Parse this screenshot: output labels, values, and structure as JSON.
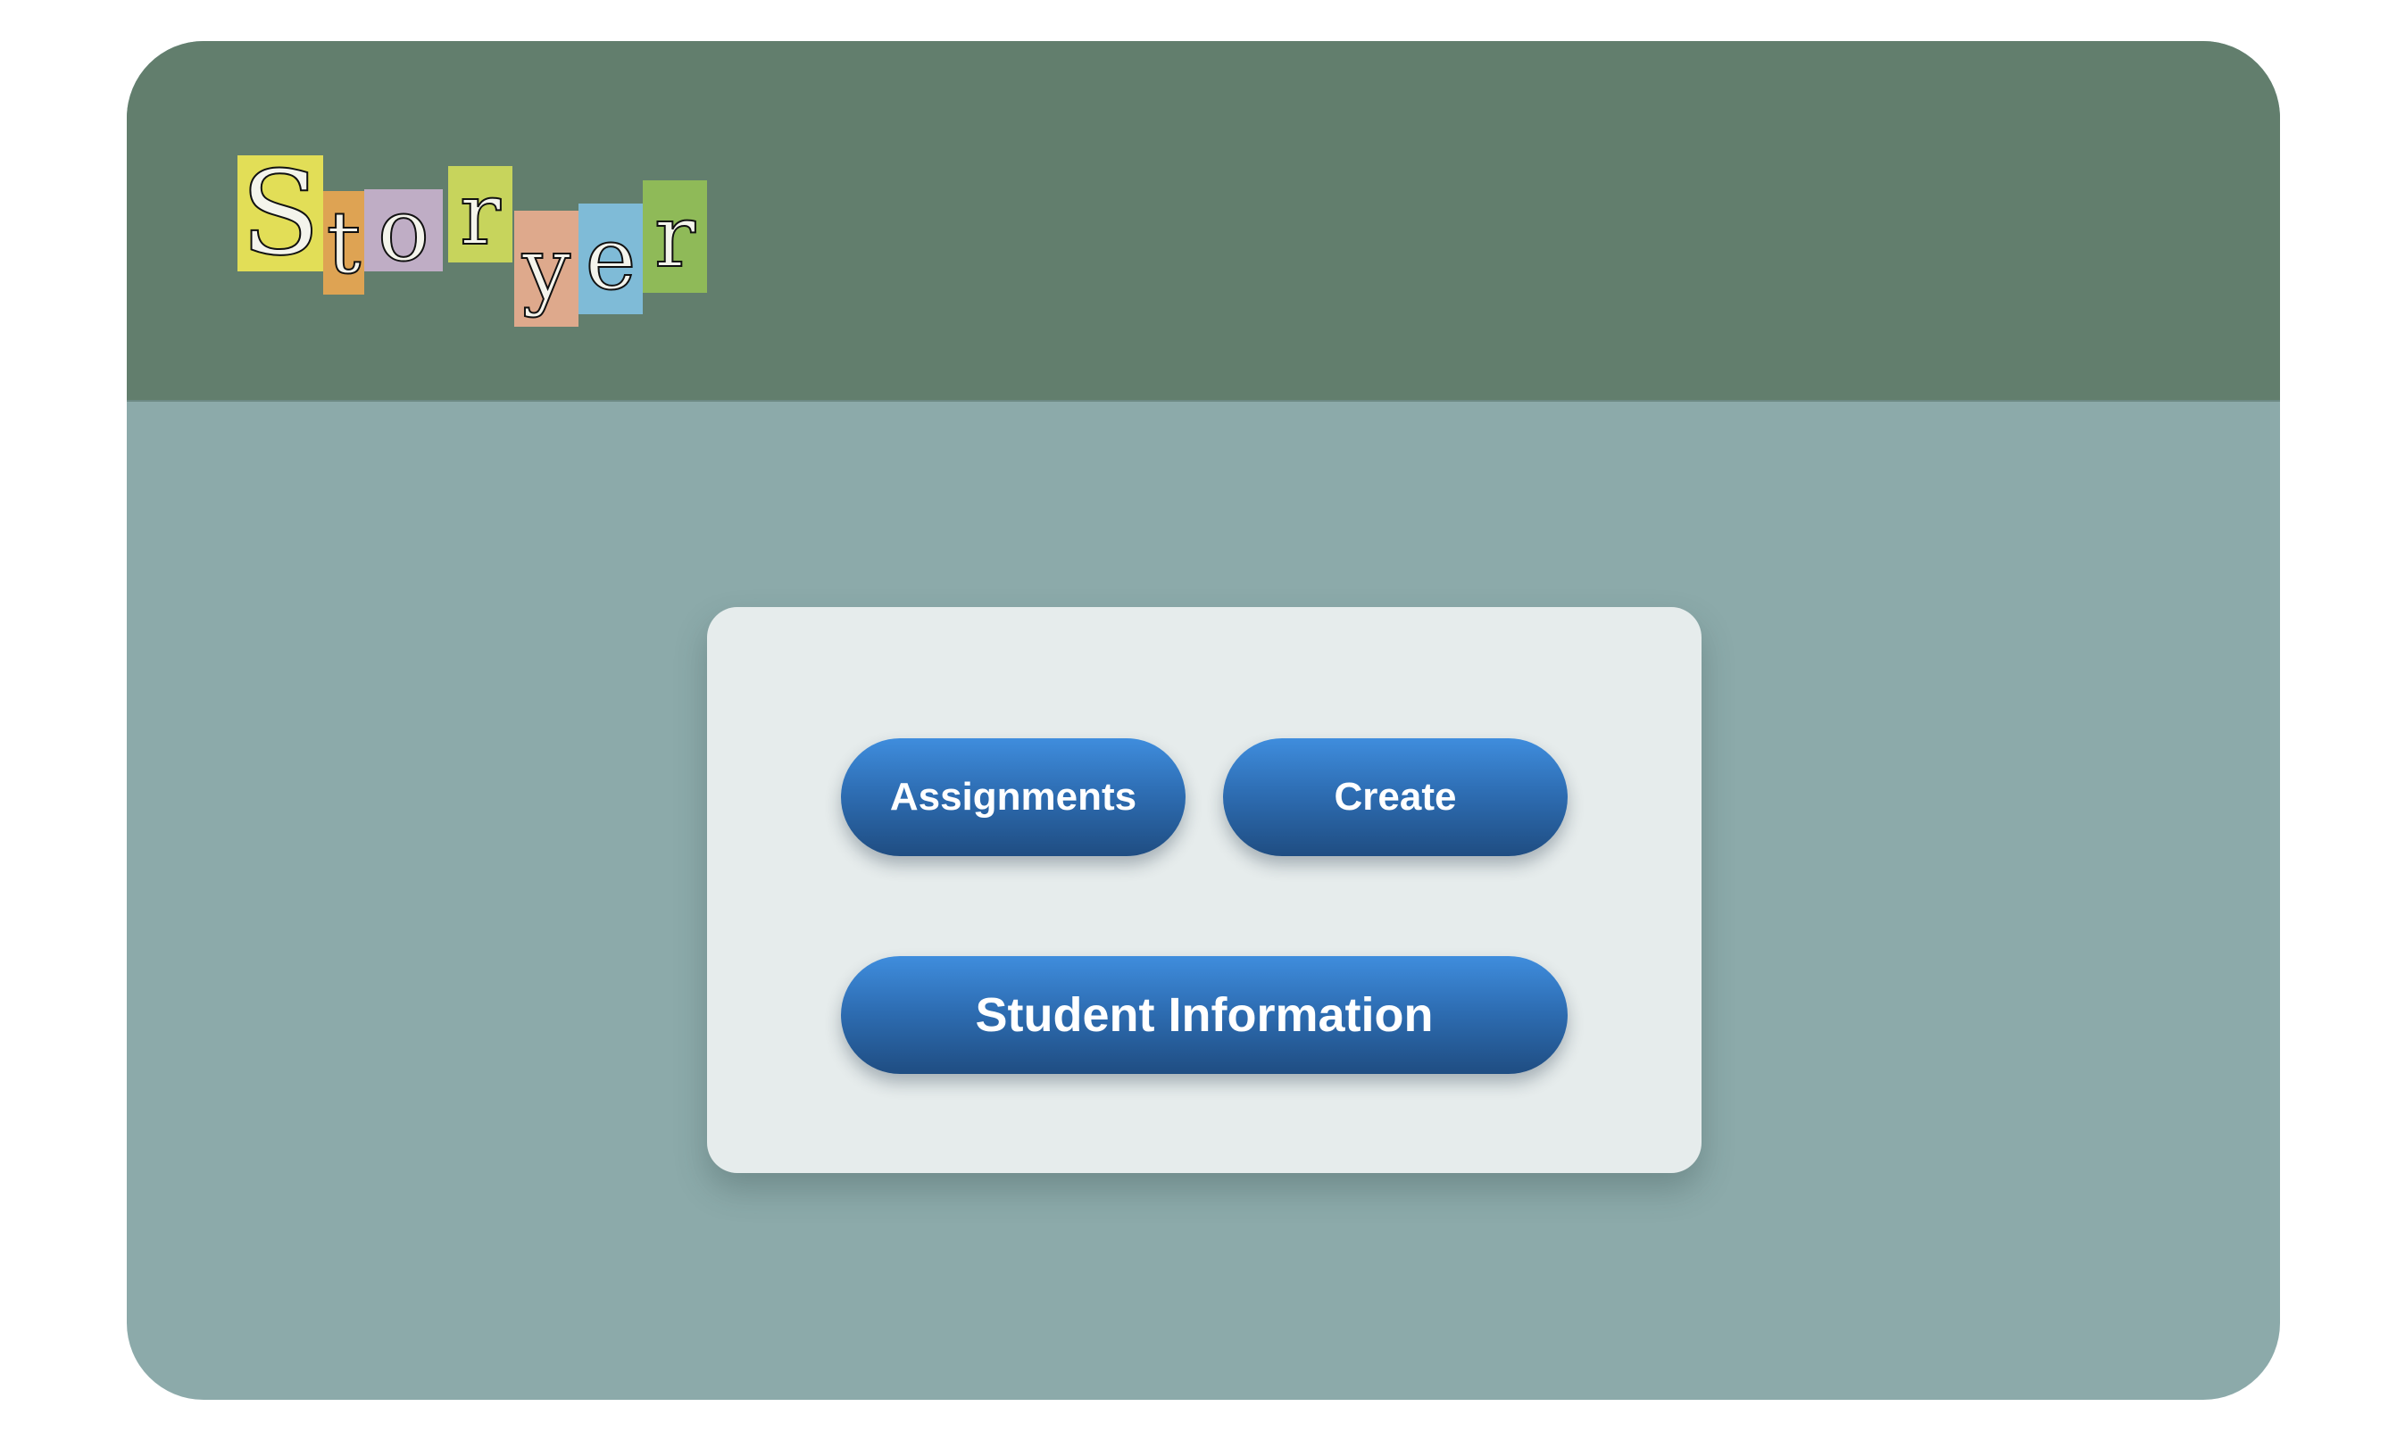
{
  "app": {
    "logo": {
      "text": "Storyer",
      "letters": [
        {
          "char": "S",
          "bg": "#e2de57"
        },
        {
          "char": "t",
          "bg": "#dea353"
        },
        {
          "char": "o",
          "bg": "#bfadc5"
        },
        {
          "char": "r",
          "bg": "#c7d45c"
        },
        {
          "char": "y",
          "bg": "#dea98c"
        },
        {
          "char": "e",
          "bg": "#7fbbd7"
        },
        {
          "char": "r",
          "bg": "#8fba58"
        }
      ]
    },
    "colors": {
      "header": "#627e6d",
      "content_bg": "#8caaaa",
      "card_bg": "#e6ecec",
      "button_blue": "#2e6eb4"
    }
  },
  "menu": {
    "assignments_label": "Assignments",
    "create_label": "Create",
    "student_information_label": "Student Information"
  }
}
